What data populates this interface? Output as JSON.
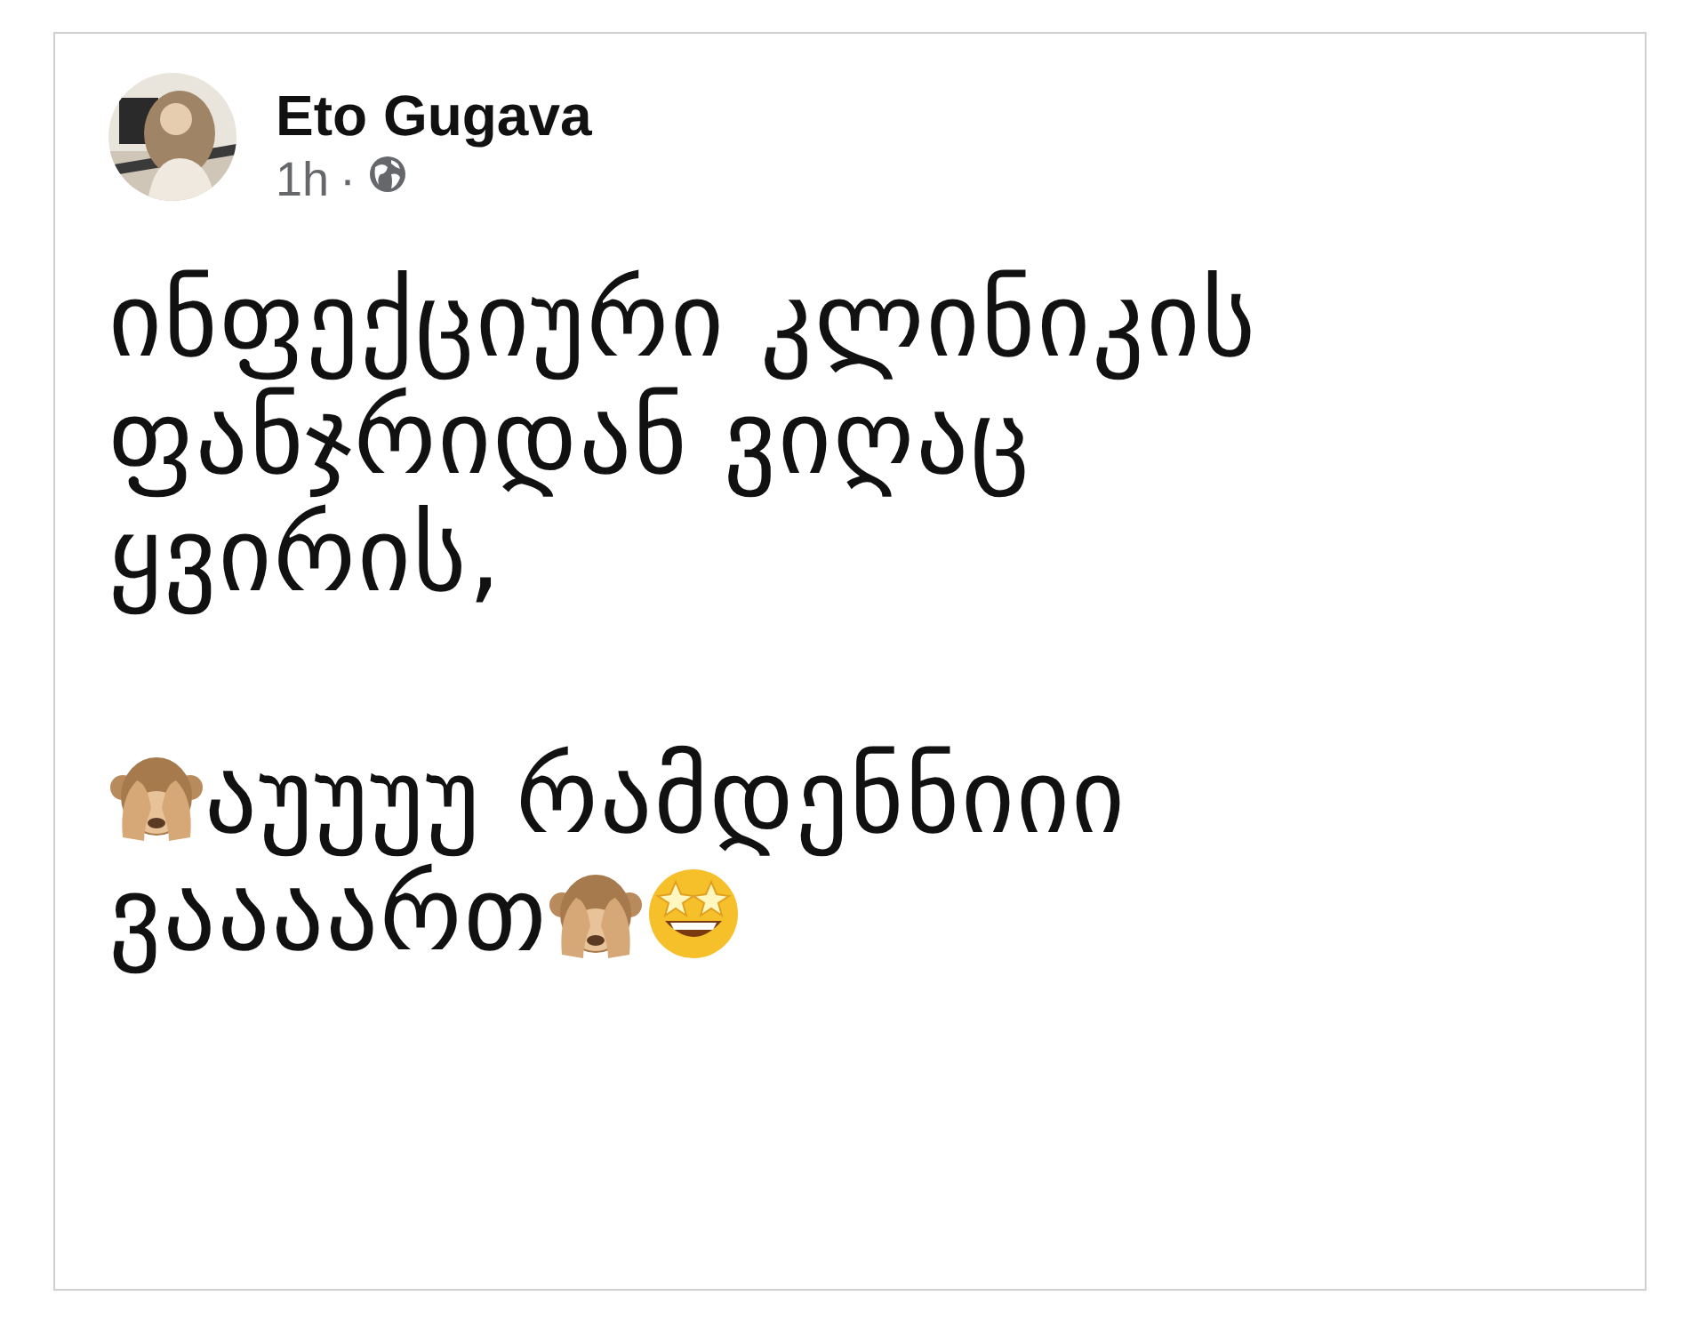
{
  "post": {
    "author": "Eto Gugava",
    "time": "1h",
    "separator": "·",
    "paragraphs": [
      {
        "lines": [
          {
            "parts": [
              {
                "kind": "text",
                "text": "ინფექციური კლინიკის"
              }
            ]
          },
          {
            "parts": [
              {
                "kind": "text",
                "text": "ფანჯრიდან ვიღაც"
              }
            ]
          },
          {
            "parts": [
              {
                "kind": "text",
                "text": "ყვირის,"
              }
            ]
          }
        ]
      },
      {
        "lines": [
          {
            "parts": [
              {
                "kind": "monkey"
              },
              {
                "kind": "text",
                "text": "აუუუუ რამდენნიიი"
              }
            ]
          },
          {
            "parts": [
              {
                "kind": "text",
                "text": "ვაააართ"
              },
              {
                "kind": "monkey"
              },
              {
                "kind": "starstruck"
              }
            ]
          }
        ]
      }
    ]
  }
}
